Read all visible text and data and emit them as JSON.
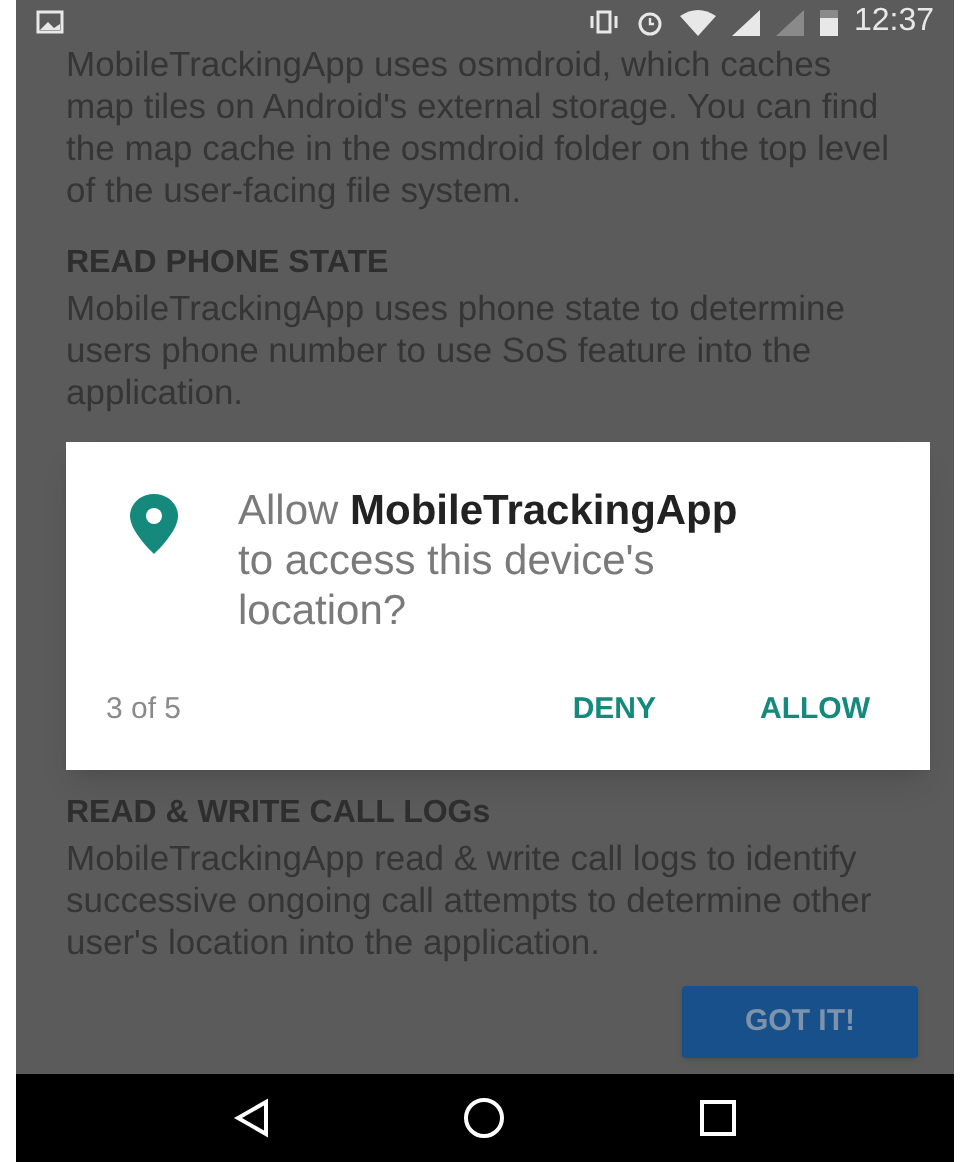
{
  "status_bar": {
    "time": "12:37"
  },
  "intro": "MobileTrackingApp uses osmdroid, which caches map tiles on Android's external storage. You can find the map cache in the osmdroid folder on the top level of the user-facing file system.",
  "sections": [
    {
      "heading": "READ PHONE STATE",
      "body": "MobileTrackingApp uses phone state to determine users phone number to use SoS feature into the application."
    },
    {
      "heading": "READ & WRITE CALL LOGs",
      "body": "MobileTrackingApp read & write call logs to identify successive ongoing call attempts to determine other user's location into the application."
    }
  ],
  "dialog": {
    "message": "Allow **MobileTrackingApp** to access this device's location?",
    "counter": "3 of 5",
    "buttons": [
      "DENY",
      "ALLOW"
    ]
  },
  "got_it_button": "GOT IT!"
}
